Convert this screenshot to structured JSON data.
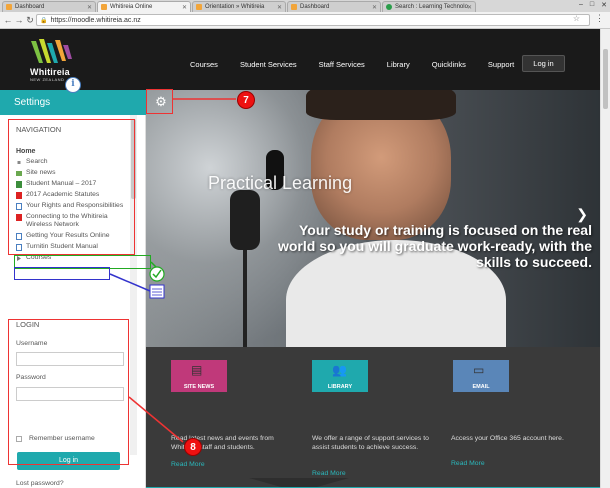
{
  "browser": {
    "tabs": [
      {
        "label": "Dashboard",
        "color": "#f2a53a"
      },
      {
        "label": "Whitireia Online",
        "color": "#f2a53a",
        "active": true
      },
      {
        "label": "Orientation » Whitireia",
        "color": "#f2a53a"
      },
      {
        "label": "Dashboard",
        "color": "#f2a53a"
      },
      {
        "label": "Search : Learning Technolo",
        "color": "#2a9d4a"
      }
    ],
    "url": "https://moodle.whitireia.ac.nz"
  },
  "site": {
    "logo_text": "Whitireia",
    "logo_sub": "NEW ZEALAND",
    "nav": [
      "Courses",
      "Student Services",
      "Staff Services",
      "Library",
      "Quicklinks",
      "Support"
    ],
    "login_label": "Log in"
  },
  "sidebar": {
    "title": "Settings",
    "nav_heading": "NAVIGATION",
    "home": "Home",
    "items": [
      {
        "label": "Search",
        "icon": "bullet-icon"
      },
      {
        "label": "Site news",
        "icon": "forum-icon"
      },
      {
        "label": "Student Manual – 2017",
        "icon": "book-icon"
      },
      {
        "label": "2017 Academic Statutes",
        "icon": "pdf-icon"
      },
      {
        "label": "Your Rights and Responsibilities",
        "icon": "file-icon"
      },
      {
        "label": "Connecting to the Whitireia Wireless Network",
        "icon": "pdf-icon"
      },
      {
        "label": "Getting Your Results Online",
        "icon": "file-icon"
      },
      {
        "label": "Turnitin Student Manual",
        "icon": "file-icon"
      },
      {
        "label": "Courses",
        "icon": "arrow-icon"
      }
    ],
    "login_heading": "LOGIN",
    "username_label": "Username",
    "password_label": "Password",
    "remember_label": "Remember username",
    "login_button": "Log in",
    "lost_password": "Lost password?"
  },
  "hero": {
    "title": "Practical Learning",
    "subtitle": "Your study or training is focused on the real world so you will graduate work-ready, with the skills to succeed."
  },
  "services": [
    {
      "label": "SITE NEWS",
      "bg": "#c0397a",
      "desc": "Read latest news and events from Whitireia staff and students.",
      "link": "Read More"
    },
    {
      "label": "LIBRARY",
      "bg": "#1fa9ad",
      "desc": "We offer a range of support services to assist students to achieve success.",
      "link": "Read More"
    },
    {
      "label": "EMAIL",
      "bg": "#5a86b8",
      "desc": "Access your Office 365 account here.",
      "link": "Read More"
    }
  ],
  "annotations": {
    "badge_7": "7",
    "badge_8": "8",
    "info": "i"
  }
}
